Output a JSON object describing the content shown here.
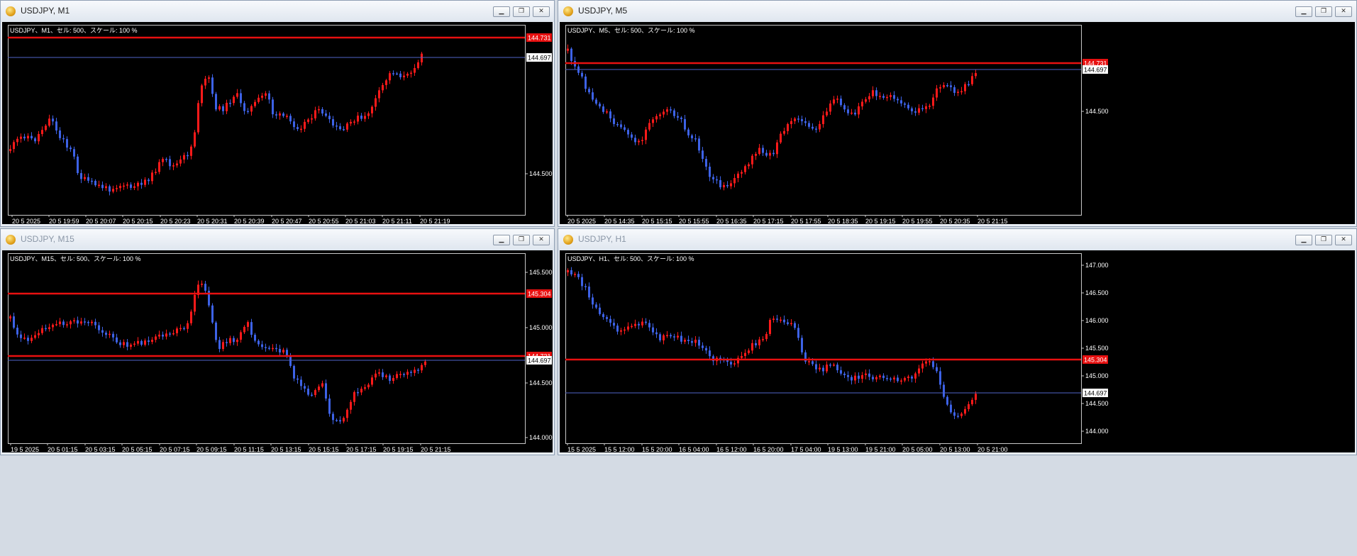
{
  "colors": {
    "bull": "#ff1a1a",
    "bear": "#3d62e6",
    "level": "#e81010",
    "price_line": "#4f63c8",
    "axis_text": "#ffffff"
  },
  "windows": [
    {
      "title": "USDJPY, M1",
      "active": true,
      "buttons": [
        "minimize-icon",
        "restore-icon",
        "close-icon"
      ],
      "chart_data": {
        "type": "candlestick",
        "header": "USDJPY、M1、セル: 500、スケール: 100 %",
        "y_ticks": [
          "144.500"
        ],
        "level_label": "144.731",
        "price_label": "144.697",
        "x_labels": [
          "20 5 2025",
          "20 5 19:59",
          "20 5 20:07",
          "20 5 20:15",
          "20 5 20:23",
          "20 5 20:31",
          "20 5 20:39",
          "20 5 20:47",
          "20 5 20:55",
          "20 5 21:03",
          "20 5 21:11",
          "20 5 21:19"
        ]
      }
    },
    {
      "title": "USDJPY, M5",
      "active": true,
      "buttons": [
        "minimize-icon",
        "restore-icon",
        "close-icon"
      ],
      "chart_data": {
        "type": "candlestick",
        "header": "USDJPY、M5、セル: 500、スケール: 100 %",
        "y_ticks": [
          "144.500"
        ],
        "level_label": "144.731",
        "price_label": "144.697",
        "x_labels": [
          "20 5 2025",
          "20 5 14:35",
          "20 5 15:15",
          "20 5 15:55",
          "20 5 16:35",
          "20 5 17:15",
          "20 5 17:55",
          "20 5 18:35",
          "20 5 19:15",
          "20 5 19:55",
          "20 5 20:35",
          "20 5 21:15"
        ]
      }
    },
    {
      "title": "USDJPY, M15",
      "active": false,
      "buttons": [
        "minimize-icon",
        "restore-icon",
        "close-icon"
      ],
      "chart_data": {
        "type": "candlestick",
        "header": "USDJPY、M15、セル: 500、スケール: 100 %",
        "y_ticks": [
          "145.500",
          "145.000",
          "144.500",
          "144.000"
        ],
        "level_label": "145.304",
        "level2_label": "144.731",
        "price_label": "144.697",
        "x_labels": [
          "19 5 2025",
          "20 5 01:15",
          "20 5 03:15",
          "20 5 05:15",
          "20 5 07:15",
          "20 5 09:15",
          "20 5 11:15",
          "20 5 13:15",
          "20 5 15:15",
          "20 5 17:15",
          "20 5 19:15",
          "20 5 21:15"
        ]
      }
    },
    {
      "title": "USDJPY, H1",
      "active": false,
      "buttons": [
        "minimize-icon",
        "restore-icon",
        "close-icon"
      ],
      "chart_data": {
        "type": "candlestick",
        "header": "USDJPY、H1、セル: 500、スケール: 100 %",
        "y_ticks": [
          "147.000",
          "146.500",
          "146.000",
          "145.500",
          "145.000",
          "144.500",
          "144.000"
        ],
        "level_label": "145.304",
        "price_label": "144.697",
        "x_labels": [
          "15 5 2025",
          "15 5 12:00",
          "15 5 20:00",
          "16 5 04:00",
          "16 5 12:00",
          "16 5 20:00",
          "17 5 04:00",
          "19 5 13:00",
          "19 5 21:00",
          "20 5 05:00",
          "20 5 13:00",
          "20 5 21:00"
        ]
      }
    }
  ]
}
